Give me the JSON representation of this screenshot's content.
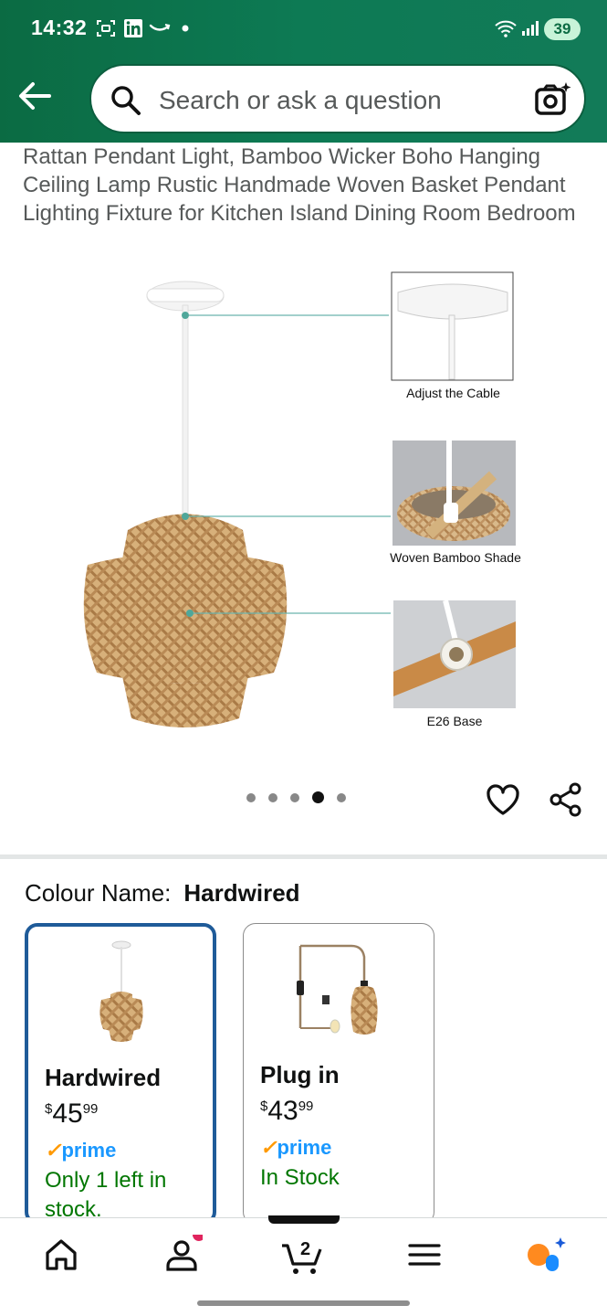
{
  "status_bar": {
    "time": "14:32",
    "battery": "39"
  },
  "search": {
    "placeholder": "Search or ask a question"
  },
  "product": {
    "title": "Rattan Pendant Light, Bamboo Wicker Boho Hanging Ceiling Lamp Rustic Handmade Woven Basket Pendant Lighting Fixture for Kitchen Island Dining Room Bedroom",
    "image_callouts": [
      "Adjust the Cable",
      "Woven Bamboo Shade",
      "E26 Base"
    ],
    "image_count": 5,
    "image_active_index": 3
  },
  "colour": {
    "label": "Colour Name:",
    "selected": "Hardwired",
    "options": [
      {
        "name": "Hardwired",
        "currency": "$",
        "price_whole": "45",
        "price_fraction": "99",
        "prime_check": "✓",
        "prime": "prime",
        "stock": "Only 1 left in stock."
      },
      {
        "name": "Plug in",
        "currency": "$",
        "price_whole": "43",
        "price_fraction": "99",
        "prime_check": "✓",
        "prime": "prime",
        "stock": "In Stock"
      }
    ]
  },
  "bottom_nav": {
    "cart_count": "2"
  },
  "colors": {
    "brand_green": "#0b6b43",
    "selected_border": "#1f5b99",
    "in_stock_green": "#007600",
    "prime_blue": "#1a98ff",
    "badge_pink": "#e0245e"
  }
}
